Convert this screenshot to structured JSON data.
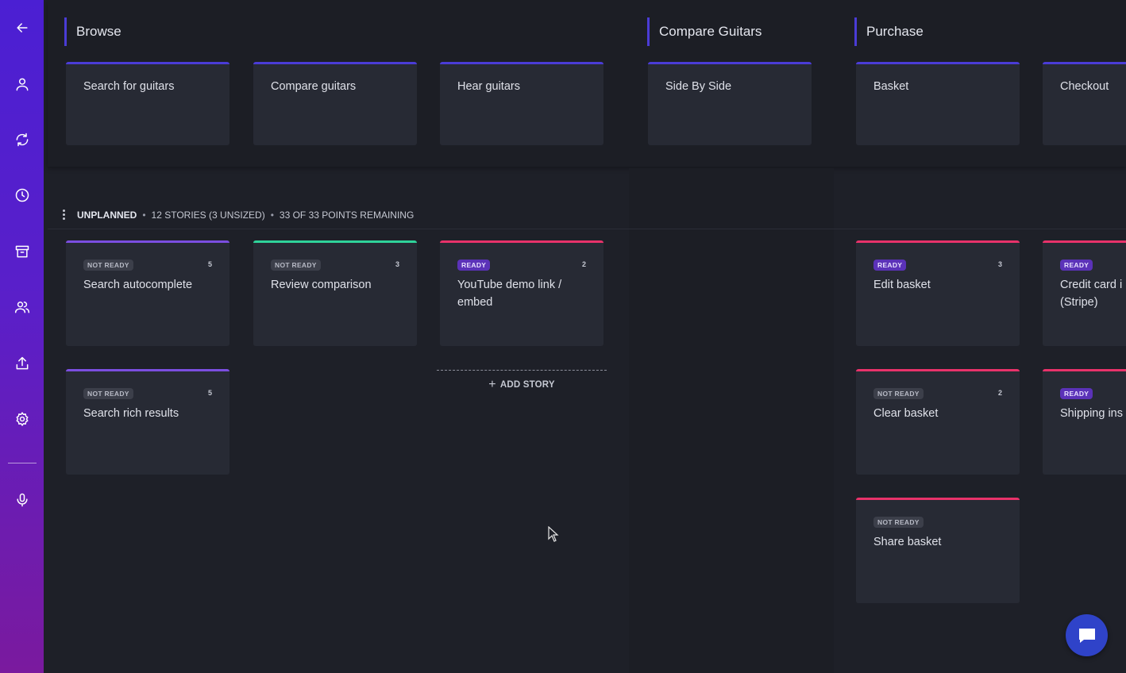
{
  "sidebar": {
    "items": [
      {
        "icon": "back-arrow-icon"
      },
      {
        "icon": "user-icon"
      },
      {
        "icon": "sync-icon"
      },
      {
        "icon": "clock-icon"
      },
      {
        "icon": "archive-icon"
      },
      {
        "icon": "team-icon"
      },
      {
        "icon": "share-icon"
      },
      {
        "icon": "gear-icon"
      },
      {
        "icon": "microphone-icon"
      }
    ]
  },
  "activities": [
    {
      "label": "Browse"
    },
    {
      "label": "Compare Guitars"
    },
    {
      "label": "Purchase"
    }
  ],
  "steps": [
    {
      "label": "Search for guitars"
    },
    {
      "label": "Compare guitars"
    },
    {
      "label": "Hear guitars"
    },
    {
      "label": "Side By Side"
    },
    {
      "label": "Basket"
    },
    {
      "label": "Checkout"
    }
  ],
  "release": {
    "name": "UNPLANNED",
    "sep1": "•",
    "stories": "12 STORIES (3 UNSIZED)",
    "sep2": "•",
    "points": "33 OF 33 POINTS REMAINING"
  },
  "stories": [
    {
      "status": "NOT READY",
      "points": "5",
      "title": "Search autocomplete"
    },
    {
      "status": "NOT READY",
      "points": "3",
      "title": "Review comparison"
    },
    {
      "status": "READY",
      "points": "2",
      "title": "YouTube demo link / embed"
    },
    {
      "status": "READY",
      "points": "3",
      "title": "Edit basket"
    },
    {
      "status": "READY",
      "points": "",
      "title": "Credit card i (Stripe)"
    },
    {
      "status": "NOT READY",
      "points": "5",
      "title": "Search rich results"
    },
    {
      "status": "NOT READY",
      "points": "2",
      "title": "Clear basket"
    },
    {
      "status": "READY",
      "points": "",
      "title": "Shipping ins"
    },
    {
      "status": "NOT READY",
      "points": "",
      "title": "Share basket"
    }
  ],
  "add_story_label": "ADD STORY",
  "colors": {
    "accent": "#4a3cd6",
    "not_ready_border": "#7b4ee0",
    "green_border": "#2fd39a",
    "ready_border": "#e8326a",
    "chat": "#2f43c9"
  }
}
